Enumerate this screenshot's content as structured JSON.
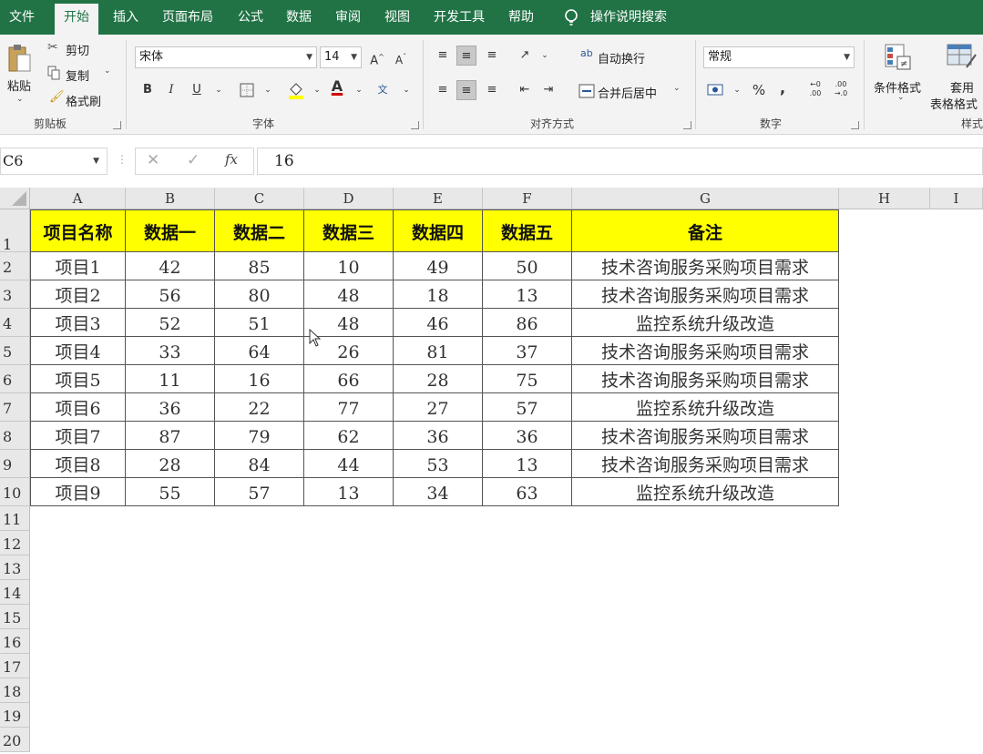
{
  "menu": {
    "tabs": [
      "文件",
      "开始",
      "插入",
      "页面布局",
      "公式",
      "数据",
      "审阅",
      "视图",
      "开发工具",
      "帮助"
    ],
    "active_tab": "开始",
    "tell_me": "操作说明搜索"
  },
  "ribbon": {
    "clipboard": {
      "paste": "粘贴",
      "cut": "剪切",
      "copy": "复制",
      "format_painter": "格式刷",
      "label": "剪贴板"
    },
    "font": {
      "font_name": "宋体",
      "font_size": "14",
      "bold": "B",
      "italic": "I",
      "underline": "U",
      "font_color_glyph": "A",
      "phonetic_glyph": "文",
      "label": "字体"
    },
    "alignment": {
      "wrap_text": "自动换行",
      "merge_center": "合并后居中",
      "label": "对齐方式"
    },
    "number": {
      "format": "常规",
      "percent": "%",
      "comma": ",",
      "label": "数字"
    },
    "styles": {
      "conditional_format": "条件格式",
      "table_format_1": "套用",
      "table_format_2": "表格格式",
      "label": "样式"
    }
  },
  "formula_bar": {
    "name_box": "C6",
    "formula": "16",
    "fx": "fx"
  },
  "sheet": {
    "columns": [
      "A",
      "B",
      "C",
      "D",
      "E",
      "F",
      "G",
      "H",
      "I"
    ],
    "row_numbers": [
      "1",
      "2",
      "3",
      "4",
      "5",
      "6",
      "7",
      "8",
      "9",
      "10",
      "11",
      "12",
      "13",
      "14",
      "15",
      "16",
      "17",
      "18",
      "19",
      "20"
    ],
    "header": [
      "项目名称",
      "数据一",
      "数据二",
      "数据三",
      "数据四",
      "数据五",
      "备注"
    ],
    "rows": [
      [
        "项目1",
        "42",
        "85",
        "10",
        "49",
        "50",
        "技术咨询服务采购项目需求"
      ],
      [
        "项目2",
        "56",
        "80",
        "48",
        "18",
        "13",
        "技术咨询服务采购项目需求"
      ],
      [
        "项目3",
        "52",
        "51",
        "48",
        "46",
        "86",
        "监控系统升级改造"
      ],
      [
        "项目4",
        "33",
        "64",
        "26",
        "81",
        "37",
        "技术咨询服务采购项目需求"
      ],
      [
        "项目5",
        "11",
        "16",
        "66",
        "28",
        "75",
        "技术咨询服务采购项目需求"
      ],
      [
        "项目6",
        "36",
        "22",
        "77",
        "27",
        "57",
        "监控系统升级改造"
      ],
      [
        "项目7",
        "87",
        "79",
        "62",
        "36",
        "36",
        "技术咨询服务采购项目需求"
      ],
      [
        "项目8",
        "28",
        "84",
        "44",
        "53",
        "13",
        "技术咨询服务采购项目需求"
      ],
      [
        "项目9",
        "55",
        "57",
        "13",
        "34",
        "63",
        "监控系统升级改造"
      ]
    ],
    "header_fill": "#ffff00",
    "ui_accent": "#217346"
  }
}
